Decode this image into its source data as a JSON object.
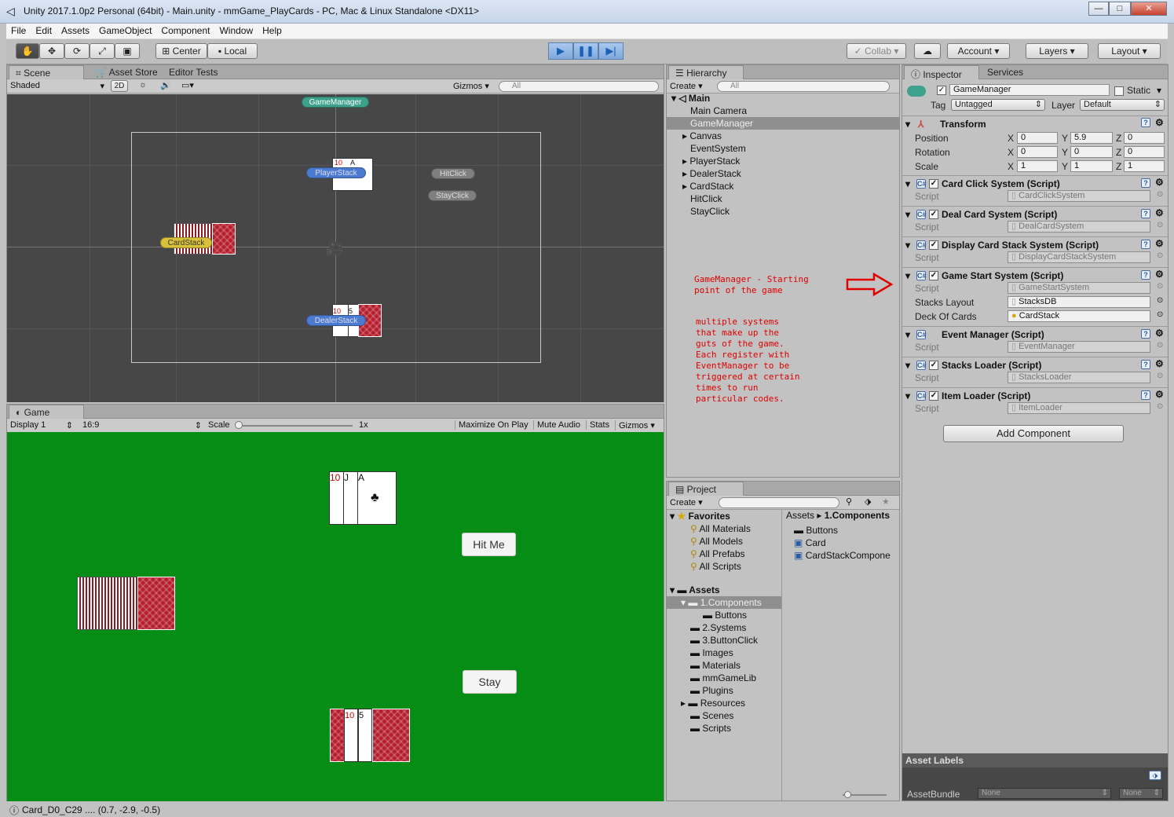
{
  "window": {
    "title": "Unity 2017.1.0p2 Personal (64bit) - Main.unity - mmGame_PlayCards - PC, Mac & Linux Standalone <DX11>"
  },
  "menu": [
    "File",
    "Edit",
    "Assets",
    "GameObject",
    "Component",
    "Window",
    "Help"
  ],
  "toolbar": {
    "pivot": "Center",
    "space": "Local",
    "collab": "Collab",
    "account": "Account",
    "layers": "Layers",
    "layout": "Layout"
  },
  "scene": {
    "tabs": [
      "Scene",
      "Asset Store",
      "Editor Tests"
    ],
    "shading": "Shaded",
    "mode2d": "2D",
    "gizmos": "Gizmos",
    "search_placeholder": "All",
    "labels": {
      "gamemanager": "GameManager",
      "playerstack": "PlayerStack",
      "hitclick": "HitClick",
      "stayclick": "StayClick",
      "cardstack": "CardStack",
      "dealerstack": "DealerStack"
    },
    "cards": {
      "p1": "10",
      "p2": "A",
      "d1": "10",
      "d2": "5"
    }
  },
  "game": {
    "tab": "Game",
    "display": "Display 1",
    "aspect": "16:9",
    "scale_label": "Scale",
    "scale_value": "1x",
    "buttons": [
      "Maximize On Play",
      "Mute Audio",
      "Stats",
      "Gizmos"
    ],
    "hit": "Hit Me",
    "stay": "Stay",
    "player_cards": [
      "10",
      "J",
      "A"
    ],
    "dealer_cards": [
      "10",
      "5"
    ]
  },
  "hierarchy": {
    "tab": "Hierarchy",
    "create": "Create",
    "search_placeholder": "All",
    "scene": "Main",
    "items": [
      "Main Camera",
      "GameManager",
      "Canvas",
      "EventSystem",
      "PlayerStack",
      "DealerStack",
      "CardStack",
      "HitClick",
      "StayClick"
    ],
    "selected": "GameManager"
  },
  "annotations": {
    "note1": "GameManager - Starting\npoint of the game",
    "note2": "multiple systems\nthat make up the\nguts of the game.\nEach register with\nEventManager to be\ntriggered at certain\ntimes to run\nparticular codes."
  },
  "project": {
    "tab": "Project",
    "create": "Create",
    "favorites_label": "Favorites",
    "favorites": [
      "All Materials",
      "All Models",
      "All Prefabs",
      "All Scripts"
    ],
    "assets_label": "Assets",
    "assets_tree": [
      "1.Components",
      "Buttons",
      "2.Systems",
      "3.ButtonClick",
      "Images",
      "Materials",
      "mmGameLib",
      "Plugins",
      "Resources",
      "Scenes",
      "Scripts"
    ],
    "breadcrumb": [
      "Assets",
      "1.Components"
    ],
    "files": [
      "Buttons",
      "Card",
      "CardStackCompone"
    ]
  },
  "inspector": {
    "tabs": [
      "Inspector",
      "Services"
    ],
    "object_name": "GameManager",
    "static_label": "Static",
    "tag_label": "Tag",
    "tag": "Untagged",
    "layer_label": "Layer",
    "layer": "Default",
    "transform": {
      "title": "Transform",
      "rows": [
        {
          "label": "Position",
          "x": "0",
          "y": "5.9",
          "z": "0"
        },
        {
          "label": "Rotation",
          "x": "0",
          "y": "0",
          "z": "0"
        },
        {
          "label": "Scale",
          "x": "1",
          "y": "1",
          "z": "1"
        }
      ]
    },
    "script_label": "Script",
    "components": [
      {
        "title": "Card Click System (Script)",
        "script": "CardClickSystem"
      },
      {
        "title": "Deal Card System (Script)",
        "script": "DealCardSystem"
      },
      {
        "title": "Display Card Stack System (Script)",
        "script": "DisplayCardStackSystem"
      },
      {
        "title": "Game Start System (Script)",
        "script": "GameStartSystem"
      },
      {
        "title": "Event Manager (Script)",
        "script": "EventManager"
      },
      {
        "title": "Stacks Loader (Script)",
        "script": "StacksLoader"
      },
      {
        "title": "Item Loader (Script)",
        "script": "ItemLoader"
      }
    ],
    "gamestart_fields": [
      {
        "label": "Stacks Layout",
        "value": "StacksDB"
      },
      {
        "label": "Deck Of Cards",
        "value": "CardStack"
      }
    ],
    "add_component": "Add Component",
    "asset_labels": "Asset Labels",
    "assetbundle_label": "AssetBundle",
    "assetbundle_value": "None",
    "assetbundle_variant": "None"
  },
  "status": "Card_D0_C29 .... (0.7, -2.9, -0.5)"
}
